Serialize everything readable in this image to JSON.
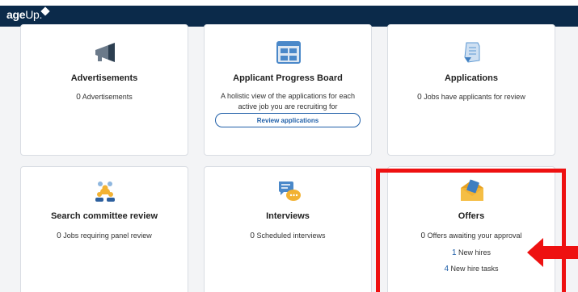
{
  "header": {
    "logo_bold": "age",
    "logo_thin": "Up."
  },
  "cards": {
    "advertisements": {
      "title": "Advertisements",
      "count": "0",
      "text": "Advertisements"
    },
    "progress_board": {
      "title": "Applicant Progress Board",
      "description": "A holistic view of the applications for each active job you are recruiting for",
      "button_label": "Review applications"
    },
    "applications": {
      "title": "Applications",
      "count": "0",
      "text": "Jobs have applicants for review"
    },
    "search_committee": {
      "title": "Search committee review",
      "count": "0",
      "text": "Jobs requiring panel review"
    },
    "interviews": {
      "title": "Interviews",
      "count": "0",
      "text": "Scheduled interviews"
    },
    "offers": {
      "title": "Offers",
      "awaiting_count": "0",
      "awaiting_text": "Offers awaiting your approval",
      "new_hires_count": "1",
      "new_hires_text": "New hires",
      "tasks_count": "4",
      "tasks_text": "New hire tasks"
    }
  },
  "colors": {
    "header_bg": "#0b2a4a",
    "link_blue": "#1f5fa8",
    "highlight_red": "#ee1111"
  },
  "icons": [
    "megaphone-icon",
    "board-icon",
    "document-icon",
    "people-icon",
    "chat-bubbles-icon",
    "envelope-icon",
    "arrow-icon"
  ]
}
